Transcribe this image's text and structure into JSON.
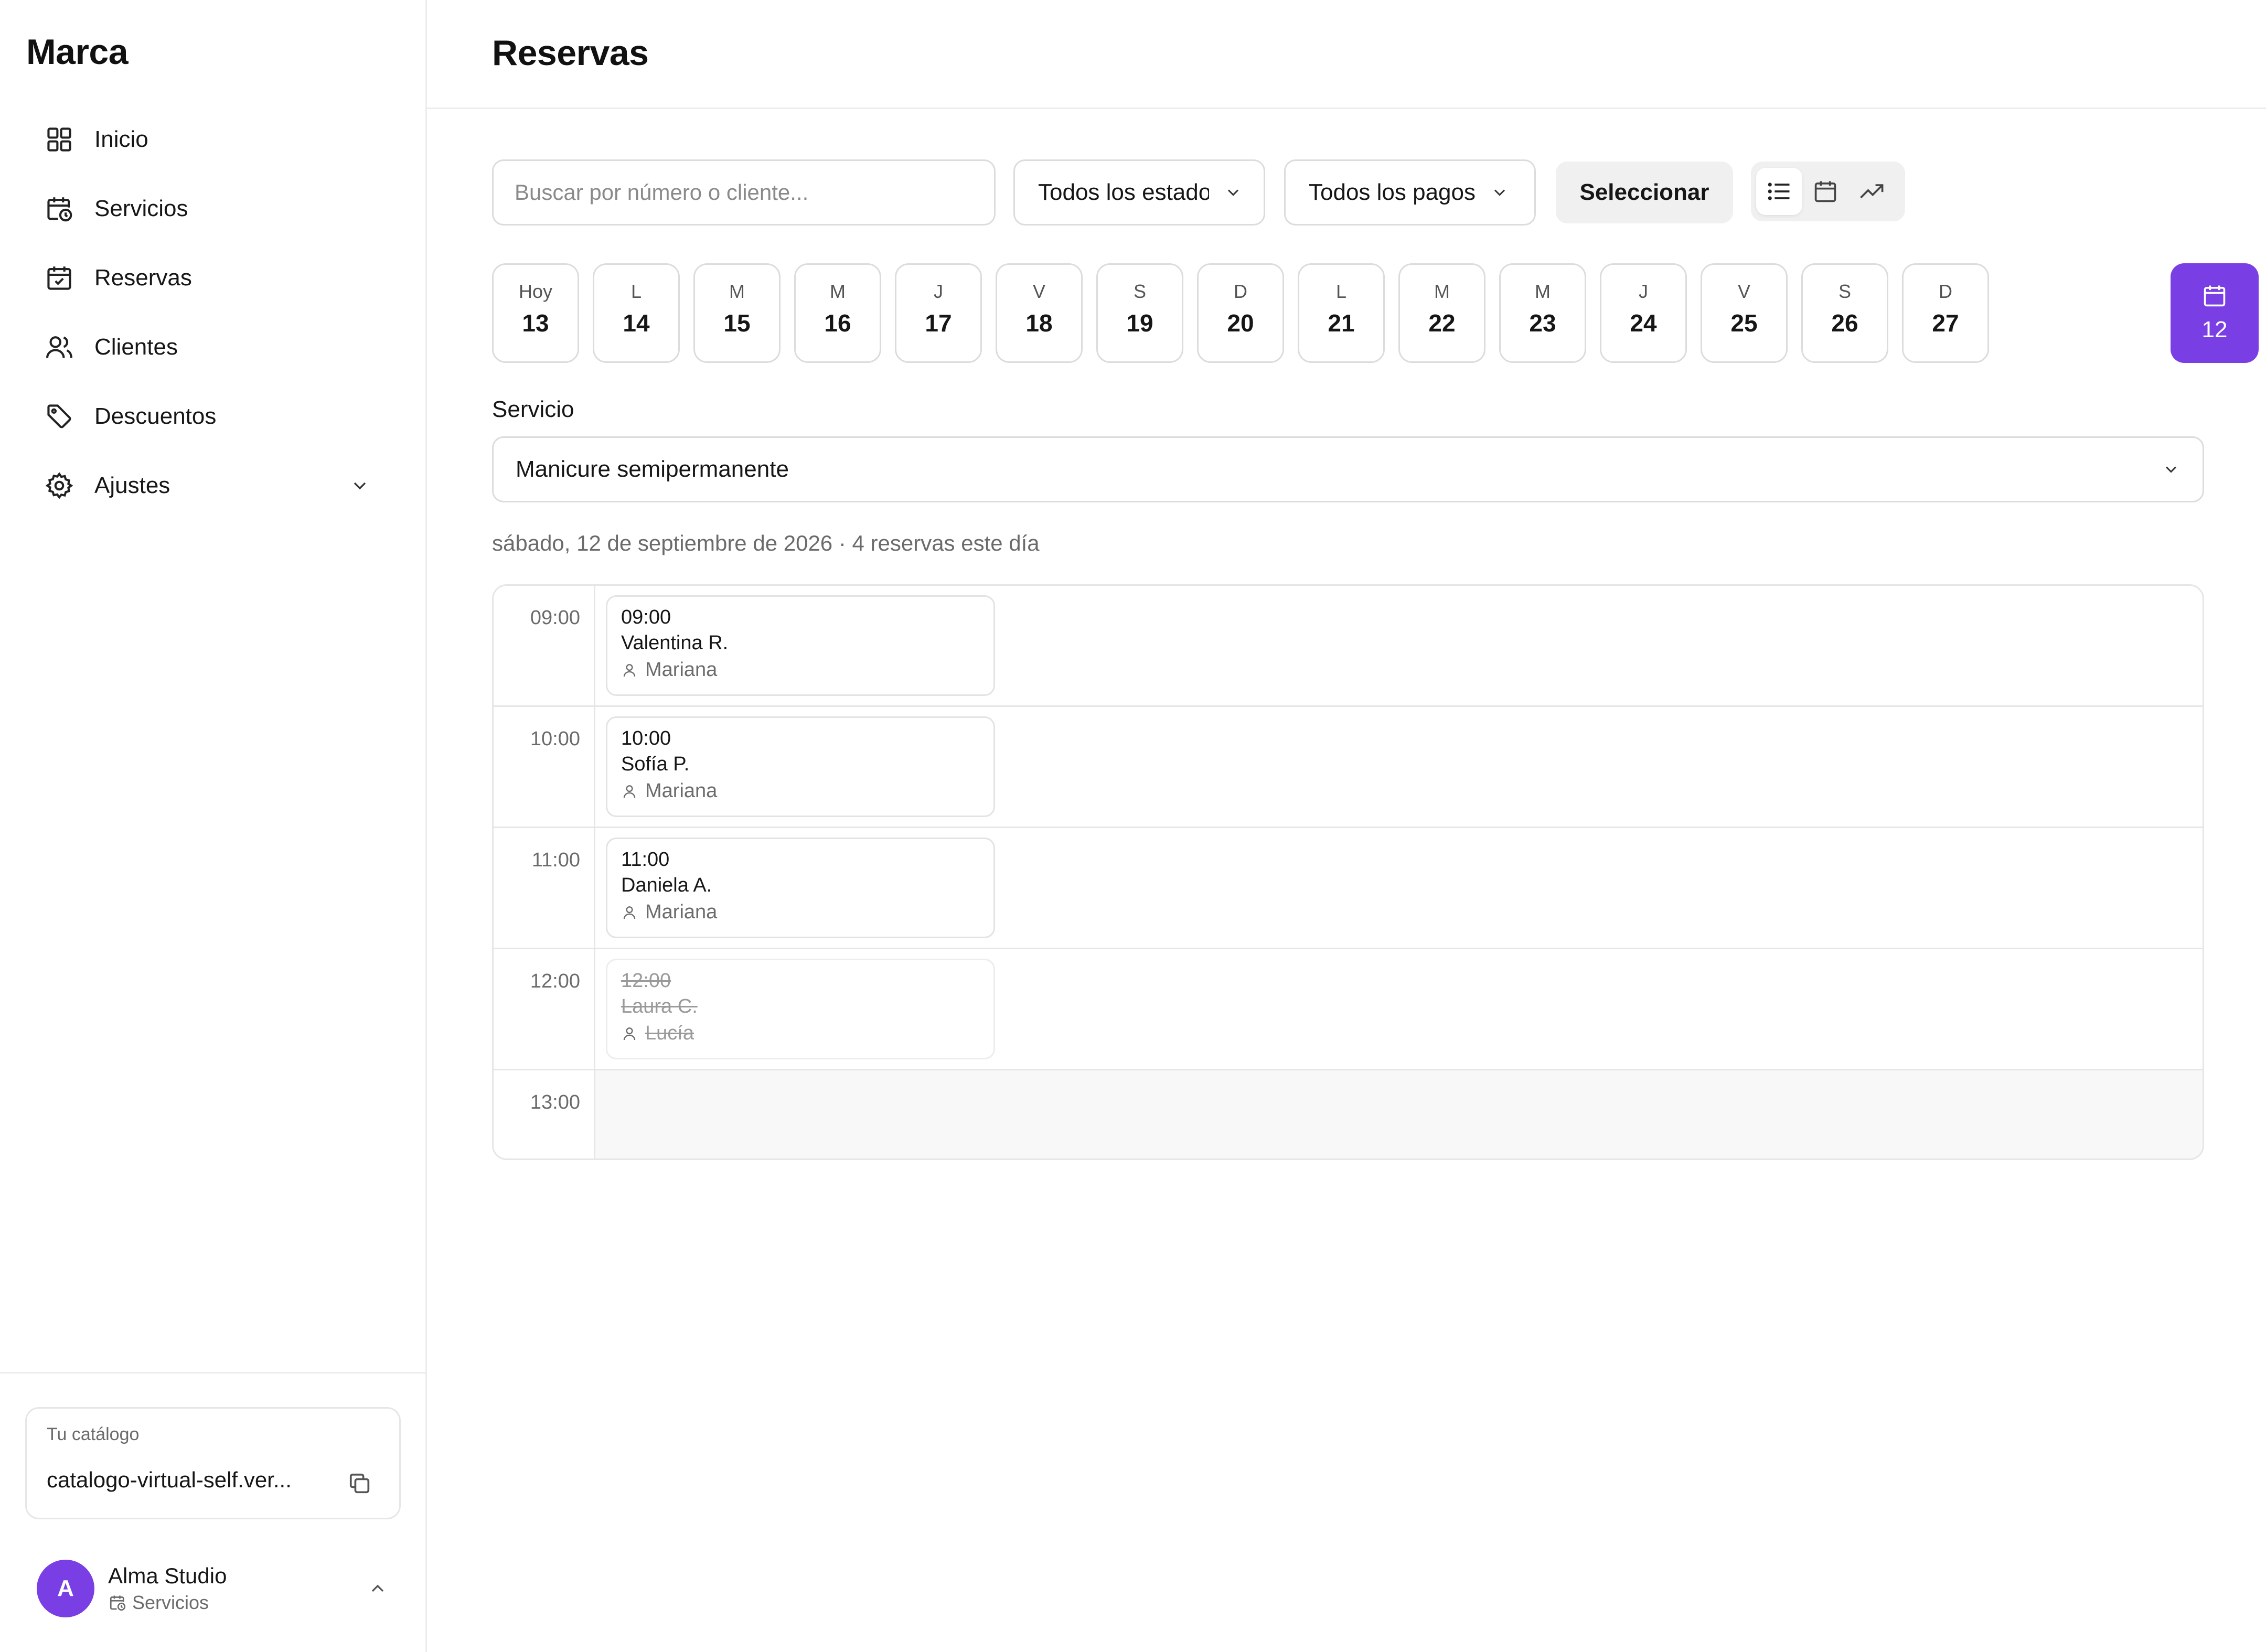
{
  "sidebar": {
    "brand": "Marca",
    "items": [
      {
        "label": "Inicio",
        "icon": "grid-icon"
      },
      {
        "label": "Servicios",
        "icon": "calendar-clock-icon"
      },
      {
        "label": "Reservas",
        "icon": "calendar-check-icon"
      },
      {
        "label": "Clientes",
        "icon": "users-icon"
      },
      {
        "label": "Descuentos",
        "icon": "tag-icon"
      },
      {
        "label": "Ajustes",
        "icon": "gear-icon"
      }
    ],
    "catalog": {
      "caption": "Tu catálogo",
      "url": "catalogo-virtual-self.ver..."
    },
    "user": {
      "initial": "A",
      "name": "Alma Studio",
      "role": "Servicios"
    }
  },
  "header": {
    "title": "Reservas"
  },
  "toolbar": {
    "search_placeholder": "Buscar por número o cliente...",
    "estados": "Todos los estados",
    "pagos": "Todos los pagos",
    "select_label": "Seleccionar",
    "views": [
      "list-icon",
      "calendar-icon",
      "trend-icon"
    ],
    "active_view": "list"
  },
  "days": [
    {
      "label": "Hoy",
      "num": "13"
    },
    {
      "label": "L",
      "num": "14"
    },
    {
      "label": "M",
      "num": "15"
    },
    {
      "label": "M",
      "num": "16"
    },
    {
      "label": "J",
      "num": "17"
    },
    {
      "label": "V",
      "num": "18"
    },
    {
      "label": "S",
      "num": "19"
    },
    {
      "label": "D",
      "num": "20"
    },
    {
      "label": "L",
      "num": "21"
    },
    {
      "label": "M",
      "num": "22"
    },
    {
      "label": "M",
      "num": "23"
    },
    {
      "label": "J",
      "num": "24"
    },
    {
      "label": "V",
      "num": "25"
    },
    {
      "label": "S",
      "num": "26"
    },
    {
      "label": "D",
      "num": "27"
    }
  ],
  "calendar_picker": {
    "selected_day": "12"
  },
  "service": {
    "label": "Servicio",
    "selected": "Manicure semipermanente"
  },
  "day_summary": "sábado, 12 de septiembre de 2026 · 4 reservas este día",
  "agenda": {
    "slots": [
      {
        "time": "09:00",
        "booking": {
          "time": "09:00",
          "client": "Valentina R.",
          "staff": "Mariana",
          "cancelled": false
        }
      },
      {
        "time": "10:00",
        "booking": {
          "time": "10:00",
          "client": "Sofía P.",
          "staff": "Mariana",
          "cancelled": false
        }
      },
      {
        "time": "11:00",
        "booking": {
          "time": "11:00",
          "client": "Daniela A.",
          "staff": "Mariana",
          "cancelled": false
        }
      },
      {
        "time": "12:00",
        "booking": {
          "time": "12:00",
          "client": "Laura C.",
          "staff": "Lucía",
          "cancelled": true
        }
      },
      {
        "time": "13:00",
        "booking": null
      }
    ]
  },
  "colors": {
    "accent": "#7a3fe4",
    "border": "#dcdcdc",
    "muted_text": "#6b6b6b"
  }
}
